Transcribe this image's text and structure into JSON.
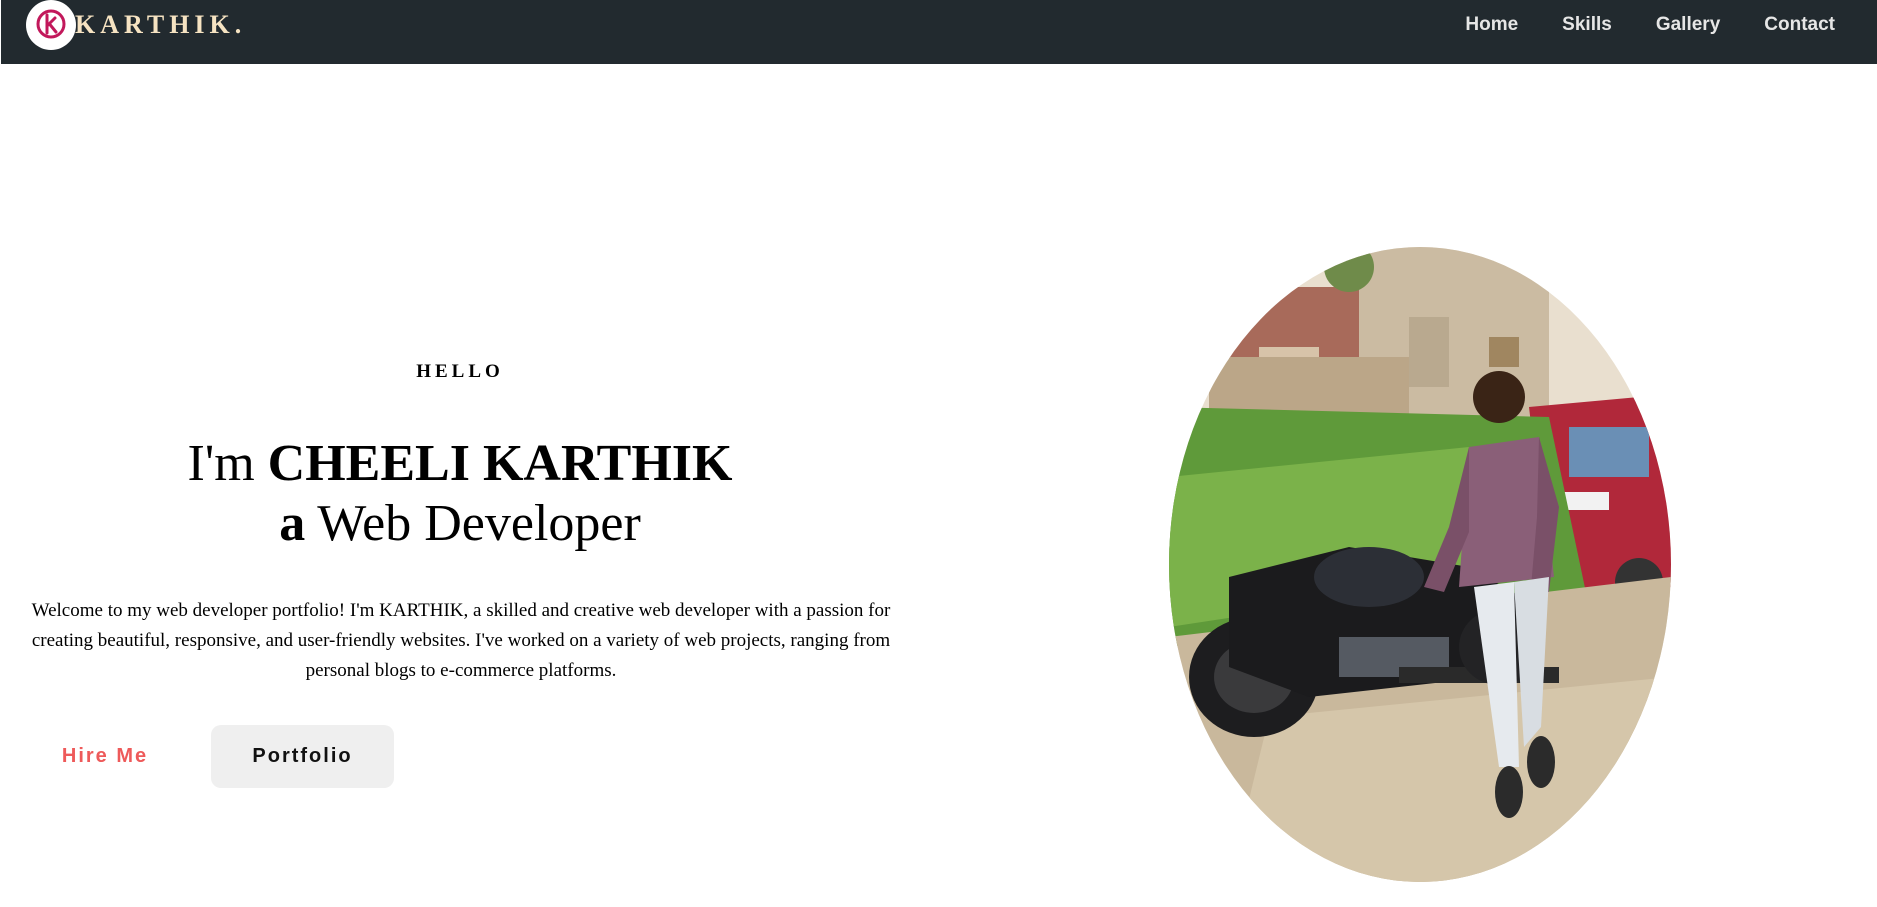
{
  "brand": {
    "name": "KARTHIK.",
    "logo_icon": "k-monogram-icon",
    "logo_color": "#c2185b",
    "text_color": "#f6e3c2"
  },
  "nav": {
    "background": "#222a2f",
    "items": [
      {
        "label": "Home"
      },
      {
        "label": "Skills"
      },
      {
        "label": "Gallery"
      },
      {
        "label": "Contact"
      }
    ]
  },
  "hero": {
    "greeting": "HELLO",
    "headline_prefix": "I'm ",
    "name": "CHEELI KARTHIK",
    "role_article": "a",
    "role": " Web Developer",
    "intro": "Welcome to my web developer portfolio! I'm KARTHIK, a skilled and creative web developer with a passion for creating beautiful, responsive, and user-friendly websites. I've worked on a variety of web projects, ranging from personal blogs to e-commerce platforms.",
    "buttons": {
      "hire_label": "Hire Me",
      "portfolio_label": "Portfolio"
    },
    "accent_color": "#ee5a5a",
    "photo": "profile-photo"
  }
}
